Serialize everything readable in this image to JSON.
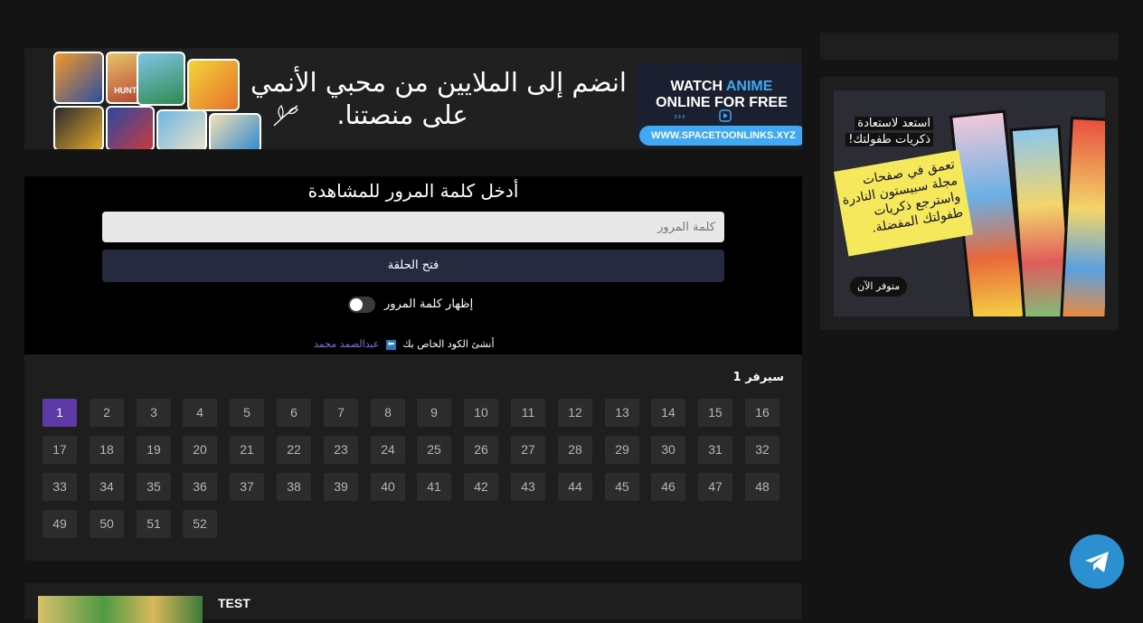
{
  "banner": {
    "arabic_line1": "انضم إلى الملايين من محبي الأنمي",
    "arabic_line2": "على منصتنا.",
    "watch_word1": "WATCH ",
    "watch_word2": "ANIME",
    "watch_line2": "ONLINE FOR FREE",
    "link_text": "WWW.SPACETOONLINKS.XYZ",
    "thumb_label": "HUNTER"
  },
  "password": {
    "title": "أدخل كلمة المرور للمشاهدة",
    "placeholder": "كلمة المرور",
    "button_label": "فتح الحلقة",
    "toggle_label": "إظهار كلمة المرور",
    "credit_text": "أنشئ الكود الخاص بك",
    "credit_author": "عبدالصمد محمد"
  },
  "episodes": {
    "server_title": "سيرفر 1",
    "active": "1",
    "items": [
      "1",
      "2",
      "3",
      "4",
      "5",
      "6",
      "7",
      "8",
      "9",
      "10",
      "11",
      "12",
      "13",
      "14",
      "15",
      "16",
      "17",
      "18",
      "19",
      "20",
      "21",
      "22",
      "23",
      "24",
      "25",
      "26",
      "27",
      "28",
      "29",
      "30",
      "31",
      "32",
      "33",
      "34",
      "35",
      "36",
      "37",
      "38",
      "39",
      "40",
      "41",
      "42",
      "43",
      "44",
      "45",
      "46",
      "47",
      "48",
      "49",
      "50",
      "51",
      "52"
    ]
  },
  "post": {
    "title": "TEST"
  },
  "sidebar_ad": {
    "heading_line1": "استعد لاستعادة",
    "heading_line2": "ذكريات طفولتك!",
    "body": "تعمق في صفحات مجلة سبيستون النادرة واسترجع ذكريات طفولتك المفضلة.",
    "badge": "متوفر الآن"
  },
  "colors": {
    "accent": "#5d3aa5",
    "link": "#8e6dd6",
    "telegram": "#2b8fd0"
  },
  "icons": {
    "telegram": "telegram-icon",
    "play": "play-icon",
    "leaf": "leaf-icon",
    "arrow": "left-arrow-icon"
  }
}
